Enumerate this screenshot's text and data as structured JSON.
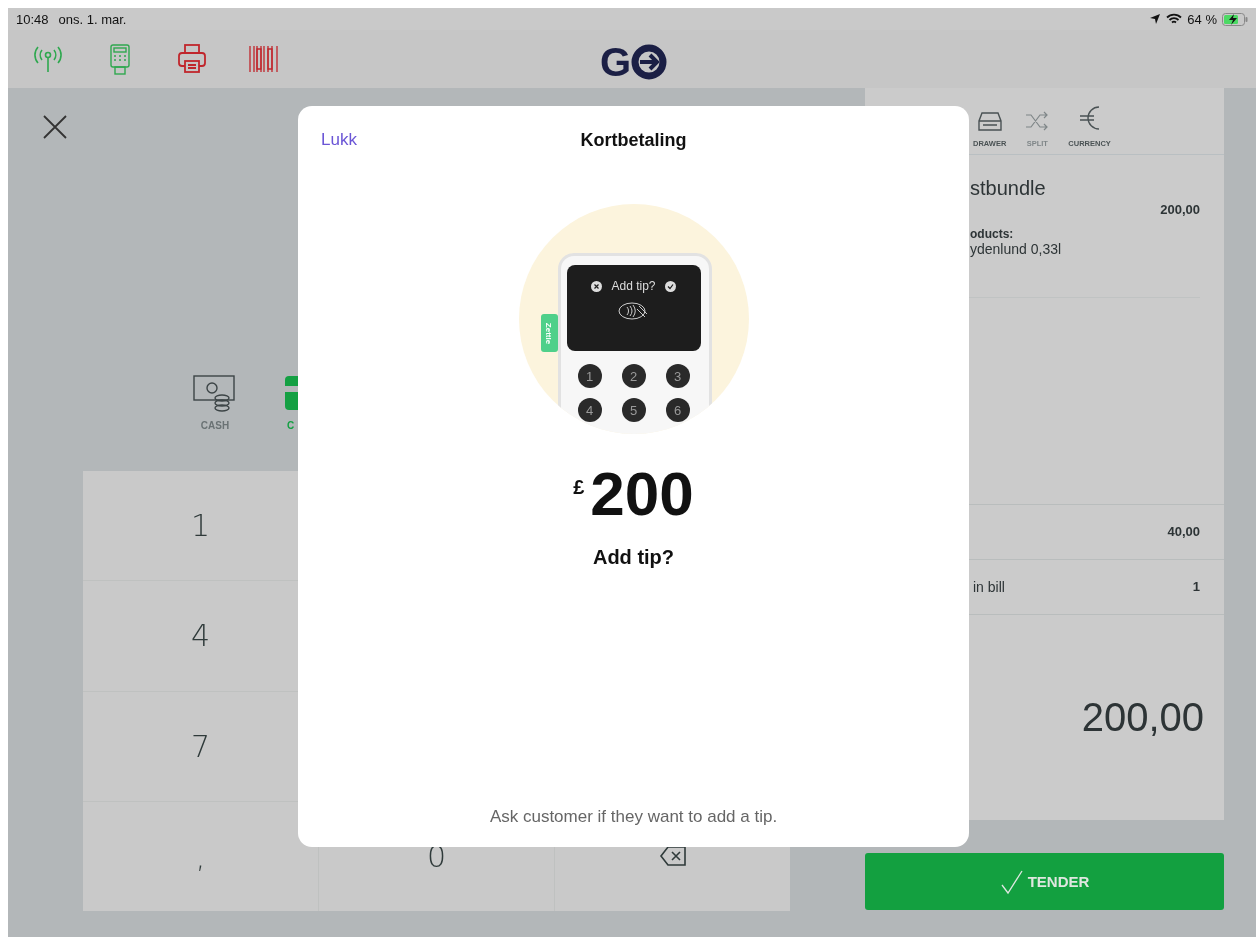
{
  "status_bar": {
    "time": "10:48",
    "date": "ons. 1. mar.",
    "battery": "64 %"
  },
  "toolbar": {
    "logo": "G"
  },
  "payment_methods": [
    {
      "label": "CASH",
      "kind": "cash",
      "selected": false
    },
    {
      "label": "C",
      "kind": "card",
      "selected": true
    }
  ],
  "keypad": {
    "keys": [
      {
        "kind": "digit",
        "label": "1"
      },
      {
        "kind": "digit",
        "label": "4"
      },
      {
        "kind": "digit",
        "label": "7"
      },
      {
        "kind": "digit",
        "label": ","
      },
      {
        "kind": "digit",
        "label": "0"
      },
      {
        "kind": "backspace"
      }
    ]
  },
  "receipt": {
    "actions": [
      {
        "label": "DRAWER",
        "kind": "drawer",
        "disabled": false
      },
      {
        "label": "SPLIT",
        "kind": "split",
        "disabled": true
      },
      {
        "label": "CURRENCY",
        "kind": "currency",
        "disabled": false
      }
    ],
    "item": {
      "name": "stbundle",
      "price": "200,00",
      "products_label": "oducts:",
      "products": "ydenlund 0,33l"
    },
    "summary_rows": [
      {
        "value": "40,00"
      },
      {
        "label": "in bill",
        "value": "1"
      }
    ],
    "total": "200,00"
  },
  "tender_button": {
    "label": "TENDER"
  },
  "dialog": {
    "close_link": "Lukk",
    "title": "Kortbetaling",
    "illustration": {
      "brand_tag": "Zettle",
      "screen_text": "Add tip?",
      "keys": [
        "1",
        "2",
        "3",
        "4",
        "5",
        "6"
      ]
    },
    "currency": "£",
    "amount": "200",
    "prompt": "Add tip?",
    "hint": "Ask customer if they want to add a tip."
  }
}
